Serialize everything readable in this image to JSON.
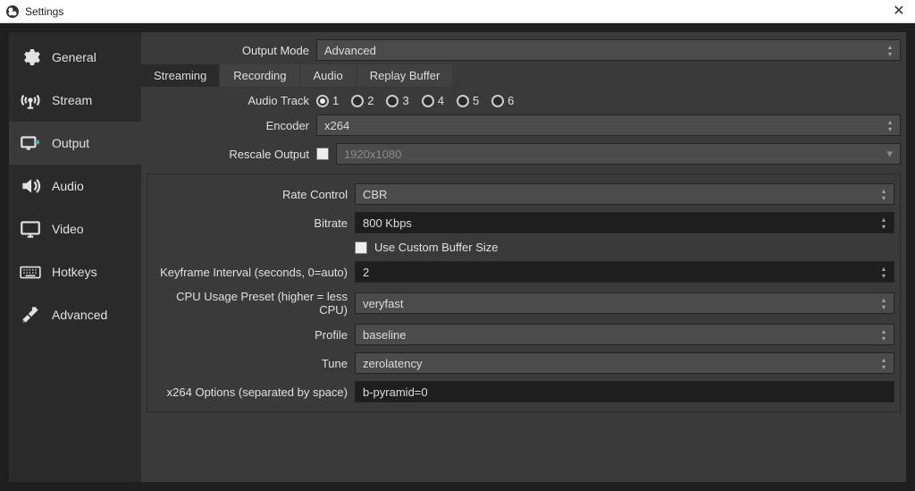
{
  "titlebar": {
    "title": "Settings"
  },
  "sidebar": {
    "items": [
      {
        "label": "General",
        "icon": "gear-icon"
      },
      {
        "label": "Stream",
        "icon": "antenna-icon"
      },
      {
        "label": "Output",
        "icon": "output-icon"
      },
      {
        "label": "Audio",
        "icon": "speaker-icon"
      },
      {
        "label": "Video",
        "icon": "monitor-icon"
      },
      {
        "label": "Hotkeys",
        "icon": "keyboard-icon"
      },
      {
        "label": "Advanced",
        "icon": "tools-icon"
      }
    ],
    "active_index": 2
  },
  "output_mode": {
    "label": "Output Mode",
    "value": "Advanced"
  },
  "tabs": {
    "items": [
      "Streaming",
      "Recording",
      "Audio",
      "Replay Buffer"
    ],
    "active_index": 0
  },
  "audio_track": {
    "label": "Audio Track",
    "options": [
      "1",
      "2",
      "3",
      "4",
      "5",
      "6"
    ],
    "selected": "1"
  },
  "encoder": {
    "label": "Encoder",
    "value": "x264"
  },
  "rescale": {
    "label": "Rescale Output",
    "checked": false,
    "placeholder": "1920x1080"
  },
  "rate_control": {
    "label": "Rate Control",
    "value": "CBR"
  },
  "bitrate": {
    "label": "Bitrate",
    "value": "800 Kbps"
  },
  "custom_buffer": {
    "label": "Use Custom Buffer Size",
    "checked": false
  },
  "keyframe": {
    "label": "Keyframe Interval (seconds, 0=auto)",
    "value": "2"
  },
  "cpu_preset": {
    "label": "CPU Usage Preset (higher = less CPU)",
    "value": "veryfast"
  },
  "profile": {
    "label": "Profile",
    "value": "baseline"
  },
  "tune": {
    "label": "Tune",
    "value": "zerolatency"
  },
  "x264opts": {
    "label": "x264 Options (separated by space)",
    "value": "b-pyramid=0"
  }
}
